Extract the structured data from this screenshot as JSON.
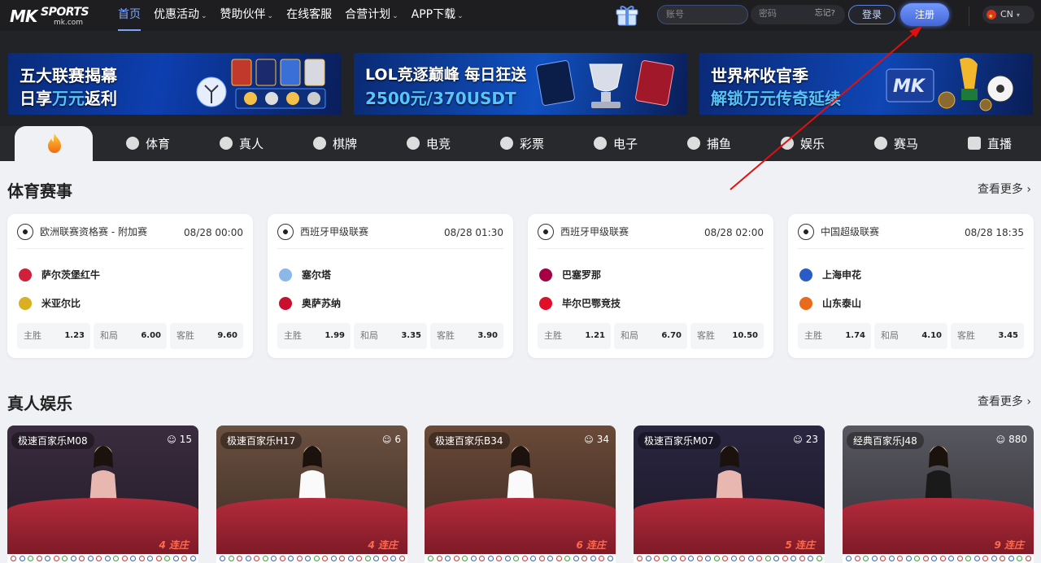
{
  "header": {
    "logo_mk": "MK",
    "logo_sports": "SPORTS",
    "logo_domain": "mk.com",
    "nav": [
      {
        "label": "首页",
        "dropdown": false,
        "active": true
      },
      {
        "label": "优惠活动",
        "dropdown": true
      },
      {
        "label": "赞助伙伴",
        "dropdown": true
      },
      {
        "label": "在线客服",
        "dropdown": false
      },
      {
        "label": "合营计划",
        "dropdown": true
      },
      {
        "label": "APP下载",
        "dropdown": true
      }
    ],
    "username_placeholder": "账号",
    "password_placeholder": "密码",
    "forgot": "忘记?",
    "login": "登录",
    "register": "注册",
    "lang": "CN"
  },
  "banners": [
    {
      "line1": "五大联赛揭幕",
      "line2a": "日享",
      "line2b": "万元",
      "line2c": "返利"
    },
    {
      "line1": "LOL竞逐巅峰 每日狂送",
      "line2a": "",
      "line2b": "2500元/370USDT",
      "line2c": ""
    },
    {
      "line1": "世界杯收官季",
      "line2a": "",
      "line2b": "解锁万元传奇延续",
      "line2c": ""
    }
  ],
  "tabs": [
    "体育",
    "真人",
    "棋牌",
    "电竞",
    "彩票",
    "电子",
    "捕鱼",
    "娱乐",
    "赛马",
    "直播"
  ],
  "sports": {
    "title": "体育赛事",
    "more": "查看更多",
    "matches": [
      {
        "league": "欧洲联赛资格赛 - 附加赛",
        "time": "08/28 00:00",
        "home": "萨尔茨堡红牛",
        "away": "米亚尔比",
        "odds": [
          {
            "l": "主胜",
            "v": "1.23"
          },
          {
            "l": "和局",
            "v": "6.00"
          },
          {
            "l": "客胜",
            "v": "9.60"
          }
        ],
        "home_color": "#d0203a",
        "away_color": "#d8b020"
      },
      {
        "league": "西班牙甲级联赛",
        "time": "08/28 01:30",
        "home": "塞尔塔",
        "away": "奥萨苏纳",
        "odds": [
          {
            "l": "主胜",
            "v": "1.99"
          },
          {
            "l": "和局",
            "v": "3.35"
          },
          {
            "l": "客胜",
            "v": "3.90"
          }
        ],
        "home_color": "#8ab8e8",
        "away_color": "#c8102e"
      },
      {
        "league": "西班牙甲级联赛",
        "time": "08/28 02:00",
        "home": "巴塞罗那",
        "away": "毕尔巴鄂竞技",
        "odds": [
          {
            "l": "主胜",
            "v": "1.21"
          },
          {
            "l": "和局",
            "v": "6.70"
          },
          {
            "l": "客胜",
            "v": "10.50"
          }
        ],
        "home_color": "#a50044",
        "away_color": "#e0102a"
      },
      {
        "league": "中国超级联赛",
        "time": "08/28 18:35",
        "home": "上海申花",
        "away": "山东泰山",
        "odds": [
          {
            "l": "主胜",
            "v": "1.74"
          },
          {
            "l": "和局",
            "v": "4.10"
          },
          {
            "l": "客胜",
            "v": "3.45"
          }
        ],
        "home_color": "#2a5cc8",
        "away_color": "#e86a1a"
      }
    ]
  },
  "live": {
    "title": "真人娱乐",
    "more": "查看更多",
    "tables": [
      {
        "name": "极速百家乐M08",
        "count": "15",
        "streak": "4 连庄"
      },
      {
        "name": "极速百家乐H17",
        "count": "6",
        "streak": "4 连庄"
      },
      {
        "name": "极速百家乐B34",
        "count": "34",
        "streak": "6 连庄"
      },
      {
        "name": "极速百家乐M07",
        "count": "23",
        "streak": "5 连庄"
      },
      {
        "name": "经典百家乐J48",
        "count": "880",
        "streak": "9 连庄"
      }
    ]
  },
  "colors": {
    "accent": "#4e7bff",
    "header_bg": "#1e1e21",
    "tab_bg": "#28292d",
    "annotation_arrow": "#e01010"
  }
}
